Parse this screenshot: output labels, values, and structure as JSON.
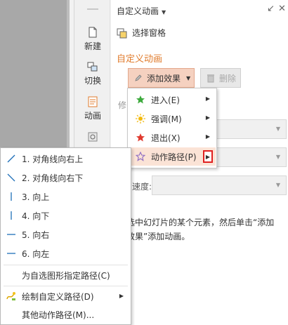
{
  "vtoolbar": {
    "new_label": "新建",
    "transition_label": "切换",
    "animation_label": "动画"
  },
  "panel": {
    "title": "自定义动画",
    "select_pane": "选择窗格",
    "section_title": "自定义动画",
    "add_effect": "添加效果",
    "delete": "删除",
    "partial_modify": "修",
    "speed_label": "速度:",
    "hint": "选中幻灯片的某个元素，然后单击“添加效果”添加动画。"
  },
  "dropdown": {
    "items": [
      {
        "label": "进入(E)",
        "icon": "green-star-icon"
      },
      {
        "label": "强调(M)",
        "icon": "sun-burst-icon"
      },
      {
        "label": "退出(X)",
        "icon": "red-star-icon"
      },
      {
        "label": "动作路径(P)",
        "icon": "outline-star-icon"
      }
    ]
  },
  "submenu": {
    "paths": [
      {
        "label": "1. 对角线向右上",
        "icon": "diagonal-up-right-icon"
      },
      {
        "label": "2. 对角线向右下",
        "icon": "diagonal-down-right-icon"
      },
      {
        "label": "3. 向上",
        "icon": "vertical-line-icon"
      },
      {
        "label": "4. 向下",
        "icon": "vertical-line-icon"
      },
      {
        "label": "5. 向右",
        "icon": "horizontal-line-icon"
      },
      {
        "label": "6. 向左",
        "icon": "horizontal-line-icon"
      }
    ],
    "custom_shape_path": "为自选图形指定路径(C)",
    "draw_custom_path": "绘制自定义路径(D)",
    "other_paths": "其他动作路径(M)..."
  },
  "colors": {
    "accent_orange": "#e07b2c",
    "active_highlight": "#fbe3d6",
    "red_box": "#e02020",
    "line_icon_blue": "#1e6fb8"
  }
}
